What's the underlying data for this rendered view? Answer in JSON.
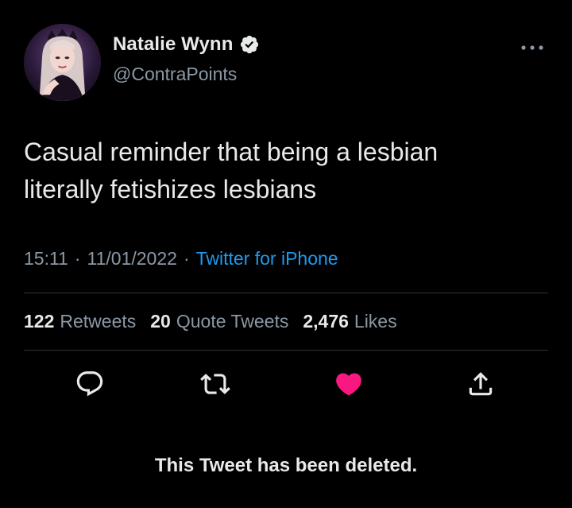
{
  "tweet": {
    "author": {
      "display_name": "Natalie Wynn",
      "handle": "@ContraPoints",
      "verified": true,
      "avatar_icon": "profile-photo"
    },
    "text": "Casual reminder that being a lesbian\nliterally fetishizes lesbians",
    "meta": {
      "time": "15:11",
      "separator1": "·",
      "date": "11/01/2022",
      "separator2": "·",
      "source": "Twitter for iPhone"
    },
    "stats": {
      "retweets_count": "122",
      "retweets_label": "Retweets",
      "quotes_count": "20",
      "quotes_label": "Quote Tweets",
      "likes_count": "2,476",
      "likes_label": "Likes"
    },
    "actions": {
      "reply_icon": "reply-icon",
      "retweet_icon": "retweet-icon",
      "like_icon": "heart-icon",
      "share_icon": "share-icon",
      "liked": true
    },
    "notice": "This Tweet has been deleted."
  },
  "colors": {
    "background": "#000000",
    "primary_text": "#e7e9ea",
    "secondary_text": "#8b98a5",
    "link": "#1d9bf0",
    "like": "#f91880",
    "divider": "#2f3336"
  }
}
